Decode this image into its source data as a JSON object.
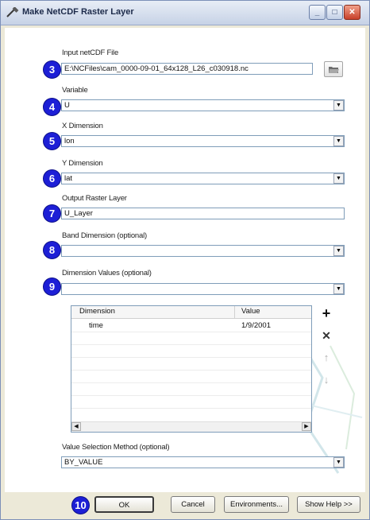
{
  "window": {
    "title": "Make NetCDF Raster Layer"
  },
  "window_controls": {
    "minimize": "_",
    "maximize": "□",
    "close": "✕"
  },
  "badges": [
    "3",
    "4",
    "5",
    "6",
    "7",
    "8",
    "9",
    "10"
  ],
  "fields": {
    "input_file": {
      "label": "Input netCDF File",
      "value": "E:\\NCFiles\\cam_0000-09-01_64x128_L26_c030918.nc"
    },
    "variable": {
      "label": "Variable",
      "value": "U"
    },
    "x_dimension": {
      "label": "X Dimension",
      "value": "lon"
    },
    "y_dimension": {
      "label": "Y Dimension",
      "value": "lat"
    },
    "output_layer": {
      "label": "Output Raster Layer",
      "value": "U_Layer"
    },
    "band_dimension": {
      "label": "Band Dimension (optional)",
      "value": ""
    },
    "dimension_values": {
      "label": "Dimension Values (optional)",
      "value": ""
    },
    "value_selection": {
      "label": "Value Selection Method (optional)",
      "value": "BY_VALUE"
    }
  },
  "table": {
    "columns": [
      "Dimension",
      "Value"
    ],
    "rows": [
      {
        "dimension": "time",
        "value": "1/9/2001"
      }
    ]
  },
  "table_buttons": {
    "add": "+",
    "remove": "✕",
    "up": "↑",
    "down": "↓"
  },
  "buttons": {
    "ok": "OK",
    "cancel": "Cancel",
    "environments": "Environments...",
    "show_help": "Show Help >>"
  }
}
